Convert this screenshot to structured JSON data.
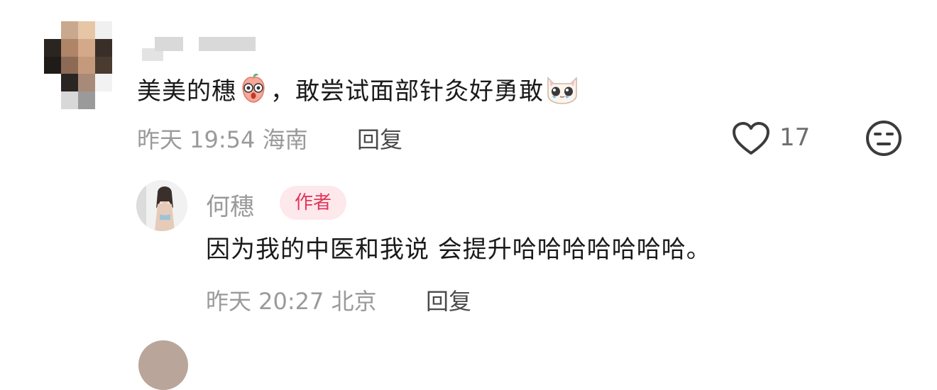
{
  "comment": {
    "text_part1": "美美的穗",
    "text_part2": "，敢尝试面部针灸好勇敢",
    "time": "昨天 19:54",
    "location": "海南",
    "reply_label": "回复",
    "like_count": "17",
    "icons": {
      "like": "heart-outline-icon",
      "dislike": "neutral-face-icon"
    }
  },
  "reply": {
    "author_name": "何穗",
    "badge": "作者",
    "text": "因为我的中医和我说 会提升哈哈哈哈哈哈哈。",
    "time": "昨天 20:27",
    "location": "北京",
    "reply_label": "回复"
  },
  "colors": {
    "badge_bg": "#fde8ec",
    "badge_text": "#e2365a",
    "meta": "#9a9a9a"
  }
}
